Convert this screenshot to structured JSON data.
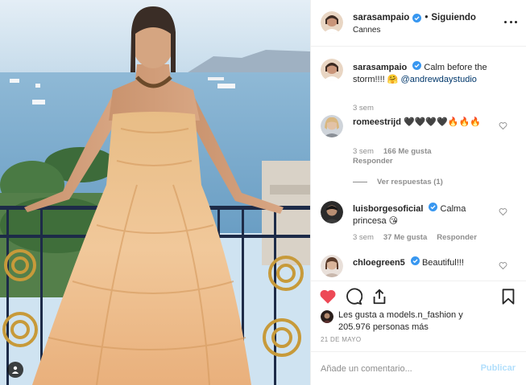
{
  "post": {
    "username": "sarasampaio",
    "separator": "•",
    "follow_state": "Siguiendo",
    "location": "Cannes",
    "icons": {
      "verified": "verified-badge-icon",
      "more": "more-options-icon",
      "tag": "user-tag-icon"
    },
    "colors": {
      "verified": "#3897f0",
      "like_active": "#ed4956",
      "link": "#00376b",
      "muted": "#8e8e8e",
      "post_disabled": "#b2dffc"
    }
  },
  "caption": {
    "username": "sarasampaio",
    "text": "Calm before the storm!!!! 🤗",
    "mention": "@andrewdaystudio",
    "time": "3 sem"
  },
  "comments": [
    {
      "username": "romeestrijd",
      "text": "🖤🖤🖤🖤🔥🔥🔥",
      "time": "3 sem",
      "likes": "166 Me gusta",
      "reply": "Responder",
      "view_replies": "Ver respuestas (1)"
    },
    {
      "username": "luisborgesoficial",
      "text": "Calma princesa 😘",
      "time": "3 sem",
      "likes": "37 Me gusta",
      "reply": "Responder"
    },
    {
      "username": "chloegreen5",
      "text": "Beautiful!!!"
    }
  ],
  "actions": {
    "like": "heart-filled-icon",
    "comment": "comment-icon",
    "share": "share-icon",
    "save": "bookmark-icon"
  },
  "likes": {
    "line1": "Les gusta a models.n_fashion y",
    "line2": "205.976 personas más"
  },
  "date": "21 DE MAYO",
  "composer": {
    "placeholder": "Añade un comentario...",
    "post_label": "Publicar"
  }
}
